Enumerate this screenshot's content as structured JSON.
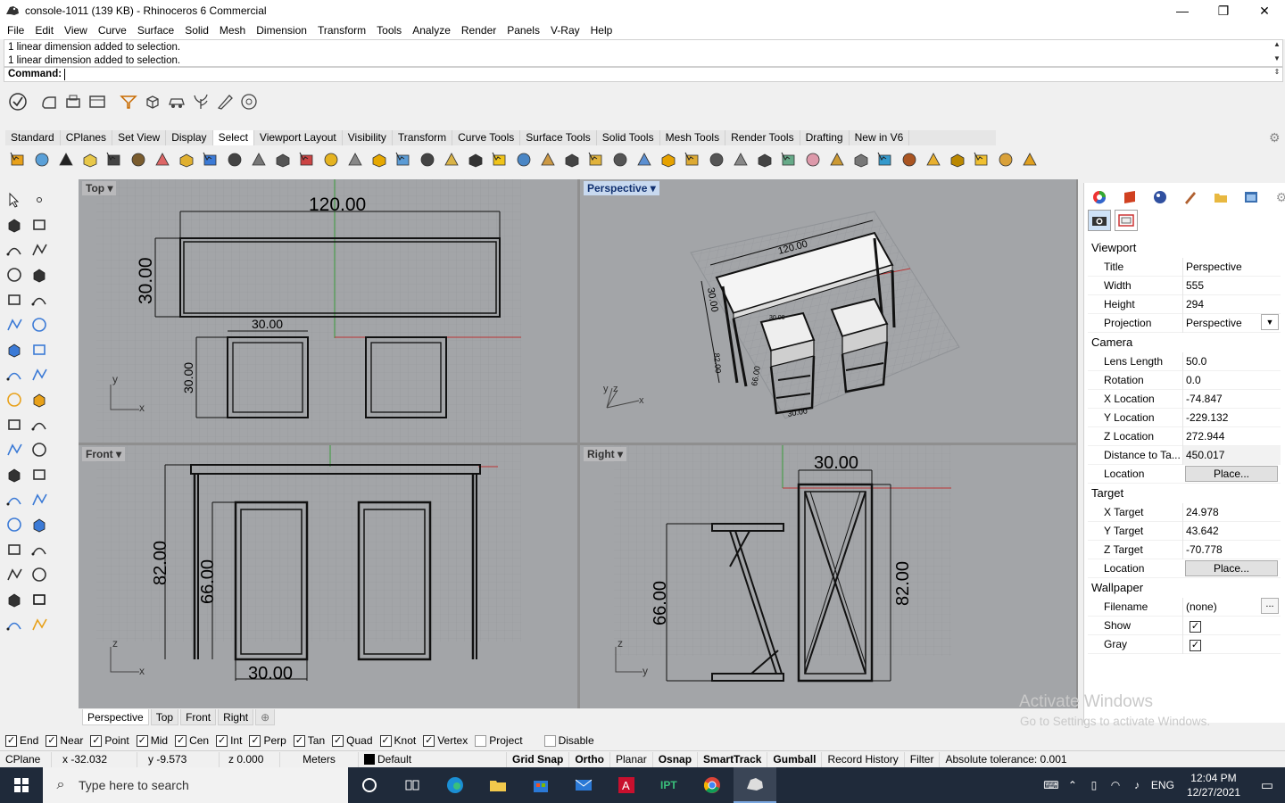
{
  "window": {
    "title": "console-1011 (139 KB) - Rhinoceros 6 Commercial"
  },
  "menu": [
    "File",
    "Edit",
    "View",
    "Curve",
    "Surface",
    "Solid",
    "Mesh",
    "Dimension",
    "Transform",
    "Tools",
    "Analyze",
    "Render",
    "Panels",
    "V-Ray",
    "Help"
  ],
  "command": {
    "history": [
      "1 linear dimension added to selection.",
      "1 linear dimension added to selection."
    ],
    "prompt": "Command:"
  },
  "toolbar_tabs": [
    "Standard",
    "CPlanes",
    "Set View",
    "Display",
    "Select",
    "Viewport Layout",
    "Visibility",
    "Transform",
    "Curve Tools",
    "Surface Tools",
    "Solid Tools",
    "Mesh Tools",
    "Render Tools",
    "Drafting",
    "New in V6"
  ],
  "active_tab": "Select",
  "viewports": {
    "top": {
      "label": "Top",
      "dims": [
        "120.00",
        "30.00",
        "30.00",
        "30.00"
      ],
      "axes": [
        "y",
        "x"
      ]
    },
    "perspective": {
      "label": "Perspective",
      "dims": [
        "120.00",
        "30.00",
        "30.00",
        "30.00",
        "66.00",
        "82.00"
      ],
      "axes": [
        "y",
        "z",
        "x"
      ]
    },
    "front": {
      "label": "Front",
      "dims": [
        "82.00",
        "66.00",
        "30.00"
      ],
      "axes": [
        "z",
        "x"
      ]
    },
    "right": {
      "label": "Right",
      "dims": [
        "30.00",
        "66.00",
        "82.00"
      ],
      "axes": [
        "z",
        "y"
      ]
    }
  },
  "viewport_tabs": [
    "Perspective",
    "Top",
    "Front",
    "Right"
  ],
  "panel": {
    "sections": {
      "viewport": "Viewport",
      "camera": "Camera",
      "target": "Target",
      "wallpaper": "Wallpaper"
    },
    "viewport_props": [
      {
        "k": "Title",
        "v": "Perspective"
      },
      {
        "k": "Width",
        "v": "555"
      },
      {
        "k": "Height",
        "v": "294"
      },
      {
        "k": "Projection",
        "v": "Perspective"
      }
    ],
    "camera_props": [
      {
        "k": "Lens Length",
        "v": "50.0"
      },
      {
        "k": "Rotation",
        "v": "0.0"
      },
      {
        "k": "X Location",
        "v": "-74.847"
      },
      {
        "k": "Y Location",
        "v": "-229.132"
      },
      {
        "k": "Z Location",
        "v": "272.944"
      },
      {
        "k": "Distance to Ta...",
        "v": "450.017"
      },
      {
        "k": "Location",
        "v": "Place..."
      }
    ],
    "target_props": [
      {
        "k": "X Target",
        "v": "24.978"
      },
      {
        "k": "Y Target",
        "v": "43.642"
      },
      {
        "k": "Z Target",
        "v": "-70.778"
      },
      {
        "k": "Location",
        "v": "Place..."
      }
    ],
    "wallpaper_props": [
      {
        "k": "Filename",
        "v": "(none)"
      },
      {
        "k": "Show",
        "v": "✓"
      },
      {
        "k": "Gray",
        "v": "✓"
      }
    ]
  },
  "watermark": {
    "line1": "Activate Windows",
    "line2": "Go to Settings to activate Windows."
  },
  "osnaps": [
    {
      "label": "End",
      "checked": true
    },
    {
      "label": "Near",
      "checked": true
    },
    {
      "label": "Point",
      "checked": true
    },
    {
      "label": "Mid",
      "checked": true
    },
    {
      "label": "Cen",
      "checked": true
    },
    {
      "label": "Int",
      "checked": true
    },
    {
      "label": "Perp",
      "checked": true
    },
    {
      "label": "Tan",
      "checked": true
    },
    {
      "label": "Quad",
      "checked": true
    },
    {
      "label": "Knot",
      "checked": true
    },
    {
      "label": "Vertex",
      "checked": true
    },
    {
      "label": "Project",
      "checked": false
    },
    {
      "label": "Disable",
      "checked": false
    }
  ],
  "status": {
    "cplane": "CPlane",
    "x": "x -32.032",
    "y": "y -9.573",
    "z": "z 0.000",
    "units": "Meters",
    "layer": "Default",
    "grid_snap": "Grid Snap",
    "ortho": "Ortho",
    "planar": "Planar",
    "osnap": "Osnap",
    "smarttrack": "SmartTrack",
    "gumball": "Gumball",
    "record_history": "Record History",
    "filter": "Filter",
    "tolerance": "Absolute tolerance: 0.001"
  },
  "taskbar": {
    "search_placeholder": "Type here to search",
    "lang": "ENG",
    "time": "12:04 PM",
    "date": "12/27/2021"
  }
}
